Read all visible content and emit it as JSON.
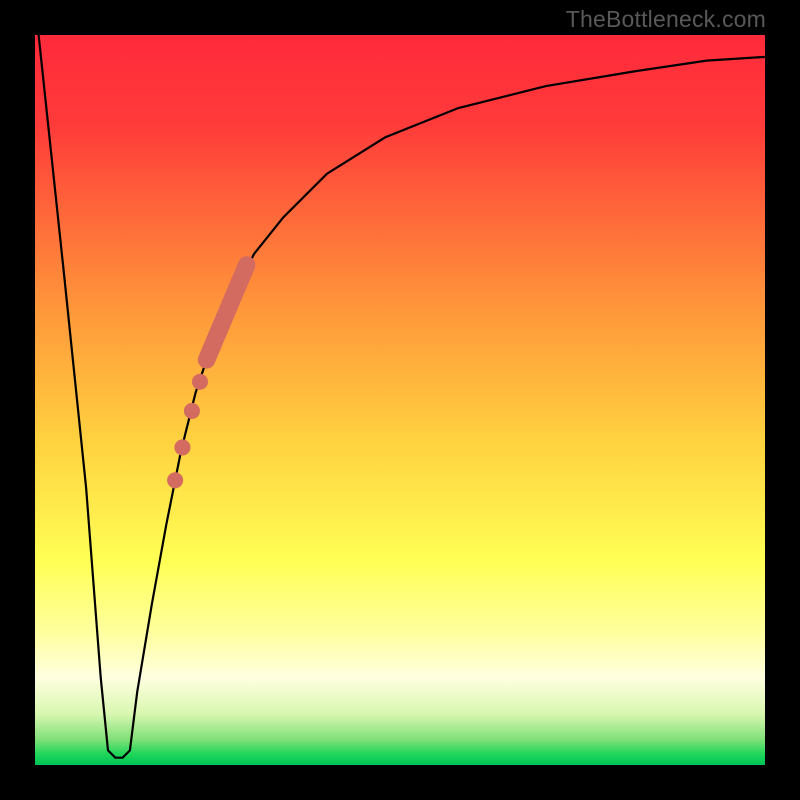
{
  "watermark": "TheBottleneck.com",
  "chart_data": {
    "type": "line",
    "title": "",
    "xlabel": "",
    "ylabel": "",
    "xlim": [
      0,
      100
    ],
    "ylim": [
      0,
      100
    ],
    "gradient_stops": [
      {
        "offset": 0.0,
        "color": "#ff2a3b"
      },
      {
        "offset": 0.12,
        "color": "#ff3a3a"
      },
      {
        "offset": 0.35,
        "color": "#ff8e3a"
      },
      {
        "offset": 0.55,
        "color": "#ffd03f"
      },
      {
        "offset": 0.72,
        "color": "#ffff55"
      },
      {
        "offset": 0.82,
        "color": "#ffffa0"
      },
      {
        "offset": 0.88,
        "color": "#ffffe0"
      },
      {
        "offset": 0.93,
        "color": "#d8f7b0"
      },
      {
        "offset": 0.965,
        "color": "#80e078"
      },
      {
        "offset": 0.985,
        "color": "#1fd65a"
      },
      {
        "offset": 1.0,
        "color": "#00c455"
      }
    ],
    "series": [
      {
        "name": "bottleneck-curve",
        "color": "#000000",
        "x": [
          0.5,
          4,
          7,
          9,
          10,
          11,
          12,
          13,
          14,
          16,
          18,
          20,
          22,
          24,
          27,
          30,
          34,
          40,
          48,
          58,
          70,
          82,
          92,
          100
        ],
        "y": [
          100,
          67,
          38,
          12,
          2,
          1,
          1,
          2,
          10,
          22,
          33,
          43,
          51,
          57,
          64,
          70,
          75,
          81,
          86,
          90,
          93,
          95,
          96.5,
          97
        ]
      }
    ],
    "markers": {
      "name": "highlight-band",
      "color": "#d46b60",
      "points": [
        {
          "x": 19.2,
          "y": 39.0,
          "r": 1.1
        },
        {
          "x": 20.2,
          "y": 43.5,
          "r": 1.1
        },
        {
          "x": 21.5,
          "y": 48.5,
          "r": 1.1
        },
        {
          "x": 22.6,
          "y": 52.5,
          "r": 1.1
        }
      ],
      "thick_segment": {
        "x1": 23.5,
        "y1": 55.5,
        "x2": 29.0,
        "y2": 68.5,
        "width": 2.4
      }
    }
  }
}
